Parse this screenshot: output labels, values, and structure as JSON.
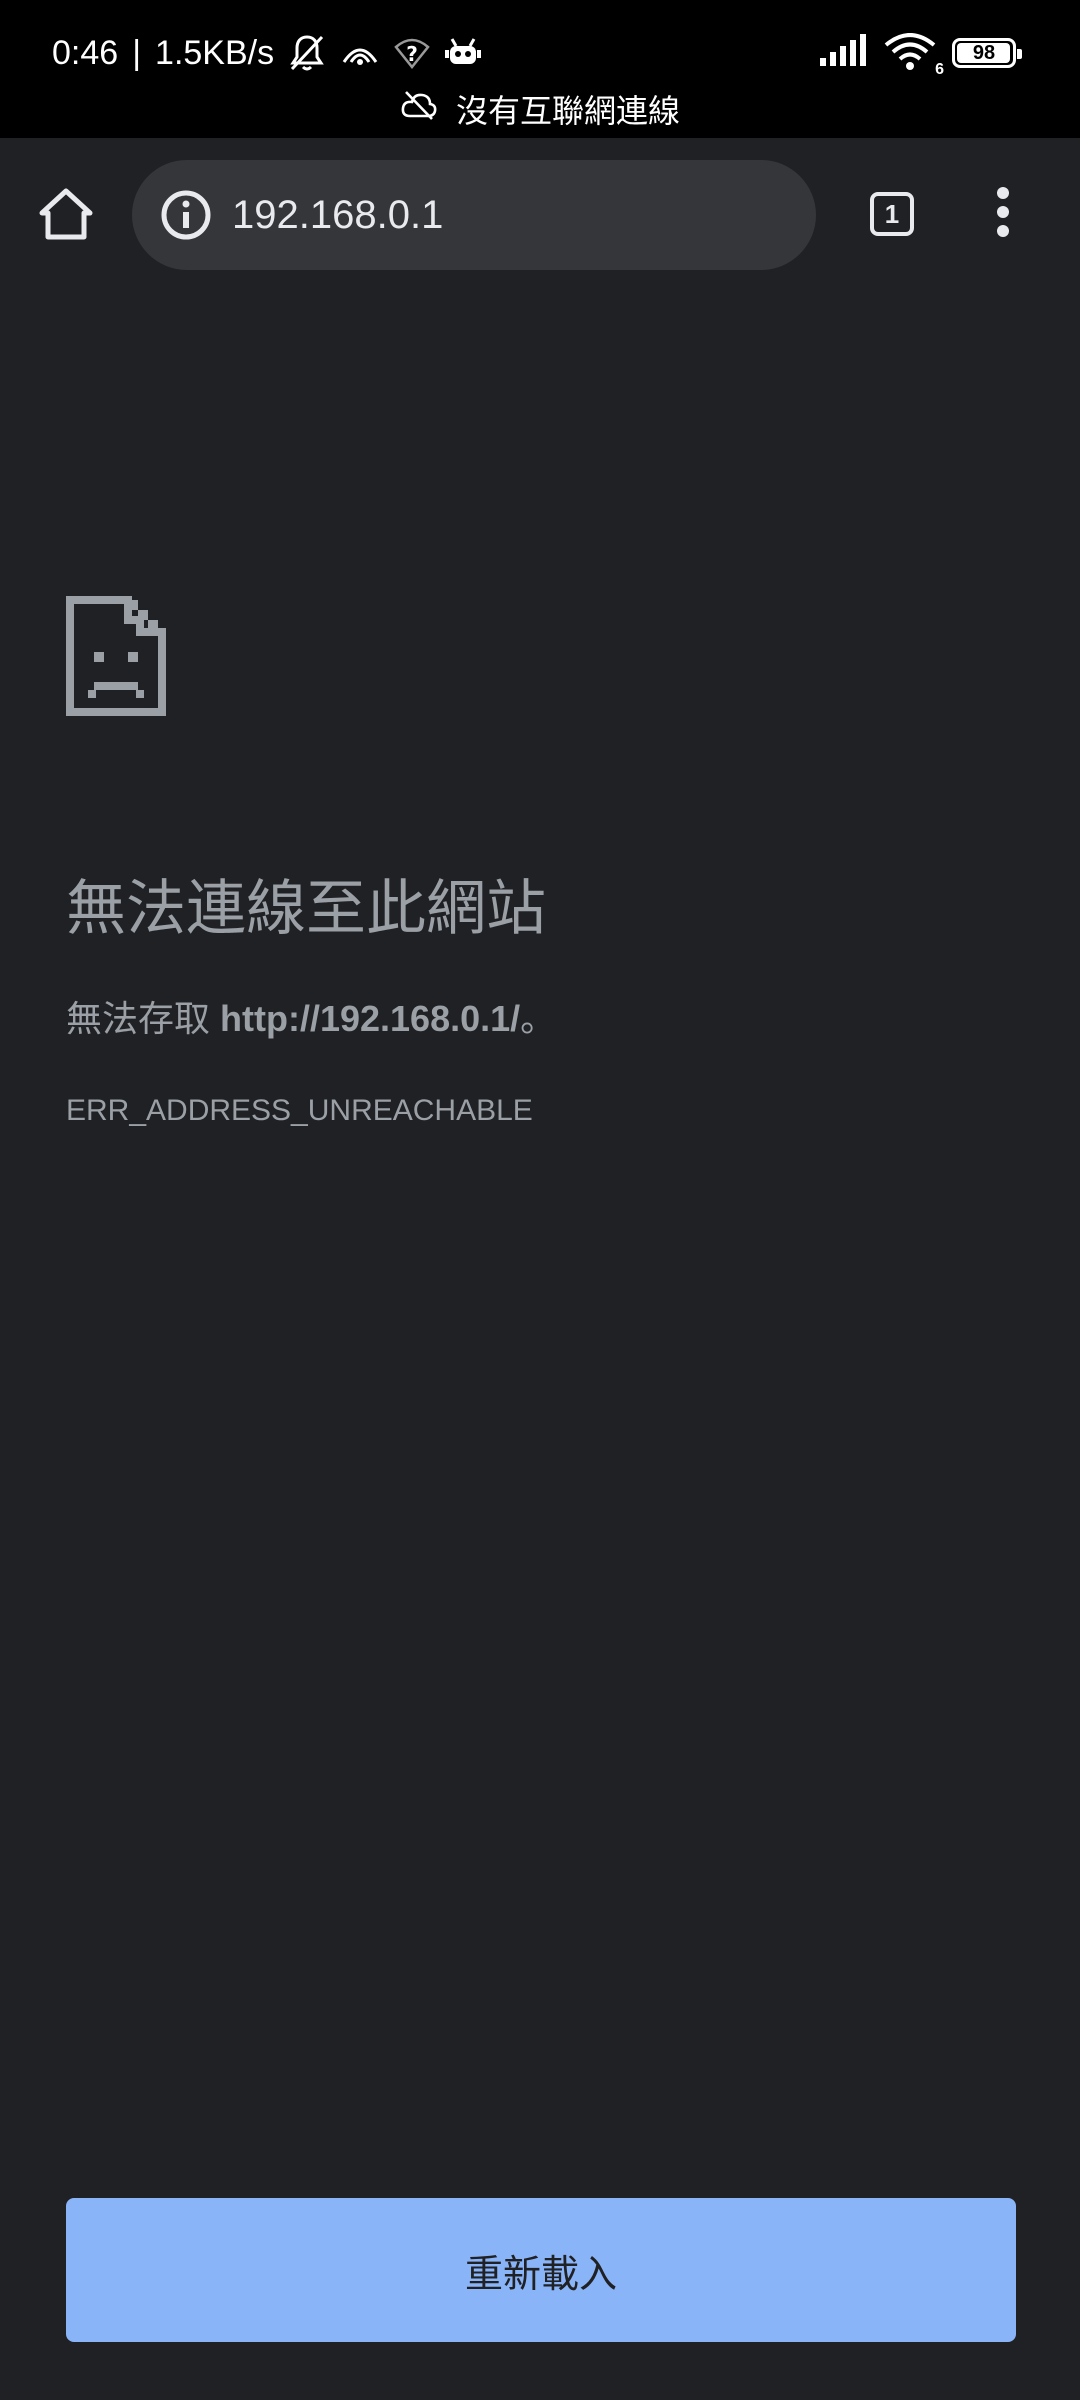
{
  "status_bar": {
    "time": "0:46",
    "separator": "|",
    "network_speed": "1.5KB/s",
    "battery_level": "98",
    "battery_fraction": 0.98,
    "wifi_badge": "6",
    "icons_left": [
      "notifications-off-icon",
      "hotspot-icon",
      "wifi-question-icon",
      "bot-icon"
    ],
    "icons_right": [
      "signal-icon",
      "wifi-icon",
      "battery-icon"
    ]
  },
  "network_banner": {
    "icon": "cloud-off-icon",
    "text": "沒有互聯網連線"
  },
  "toolbar": {
    "home_icon": "home-icon",
    "info_icon": "info-icon",
    "url": "192.168.0.1",
    "tab_count": "1",
    "menu_icon": "more-vert-icon"
  },
  "error": {
    "icon": "sad-page-icon",
    "title": "無法連線至此網站",
    "desc_prefix": "無法存取 ",
    "desc_url": "http://192.168.0.1/",
    "desc_suffix": "。",
    "code": "ERR_ADDRESS_UNREACHABLE"
  },
  "reload_button": {
    "label": "重新載入"
  },
  "colors": {
    "background": "#202124",
    "status_bar": "#000000",
    "omnibox": "#35363a",
    "text_primary": "#e8eaed",
    "text_secondary": "#9aa0a6",
    "accent": "#8ab4f8"
  }
}
